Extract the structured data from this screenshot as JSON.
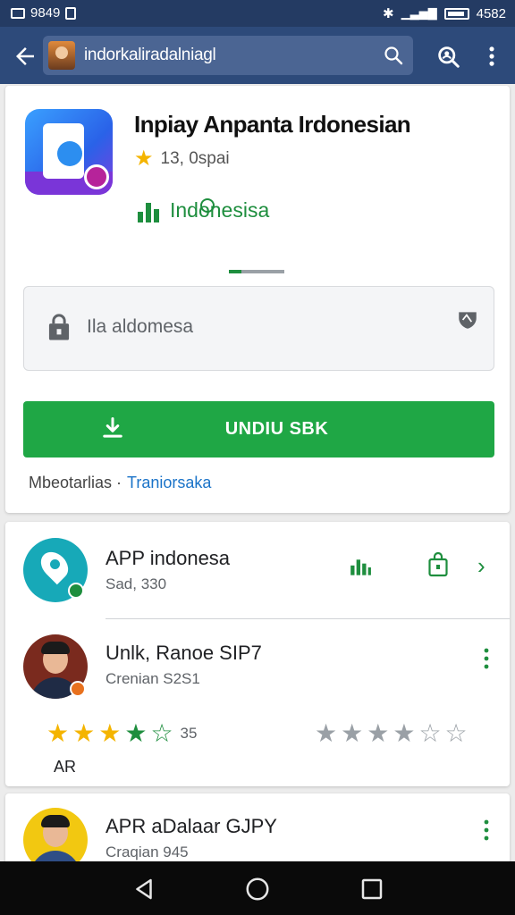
{
  "status_bar": {
    "time_left": "9849",
    "time_right": "4582"
  },
  "top_bar": {
    "url_text": "indorkaliradalniagl"
  },
  "app": {
    "title": "Inpiay Anpanta Irdonesian",
    "rating": "13, 0spai",
    "developer": "Indonesisa",
    "info_box_text": "Ila aldomesa",
    "install_label": "UNDIU SBK",
    "meta_text": "Mbeotarlias ·",
    "meta_link": "Traniorsaka"
  },
  "list": {
    "items": [
      {
        "title": "APP indonesa",
        "subtitle": "Sad, 330"
      },
      {
        "title": "Unlk, Ranoe SIP7",
        "subtitle": "Crenian S2S1"
      },
      {
        "title": "APR aDalaar GJPY",
        "subtitle": "Craqian 945"
      }
    ],
    "rating_count": "35",
    "rating_label": "AR",
    "left_stars": {
      "filled": 4,
      "total": 5
    },
    "right_stars": {
      "filled": 4,
      "total": 6
    }
  },
  "colors": {
    "status_bar": "#243b63",
    "app_bar": "#2d4a7a",
    "accent_green": "#1fa745",
    "star_yellow": "#f4b400",
    "link_blue": "#1a73c8"
  },
  "icons": {
    "back": "arrow-left-icon",
    "search": "search-icon",
    "account": "account-search-icon",
    "more": "more-vert-icon",
    "lock": "lock-icon",
    "shield": "shield-icon",
    "install": "download-icon",
    "nav": [
      "nav-back-icon",
      "nav-home-icon",
      "nav-recent-icon"
    ]
  }
}
